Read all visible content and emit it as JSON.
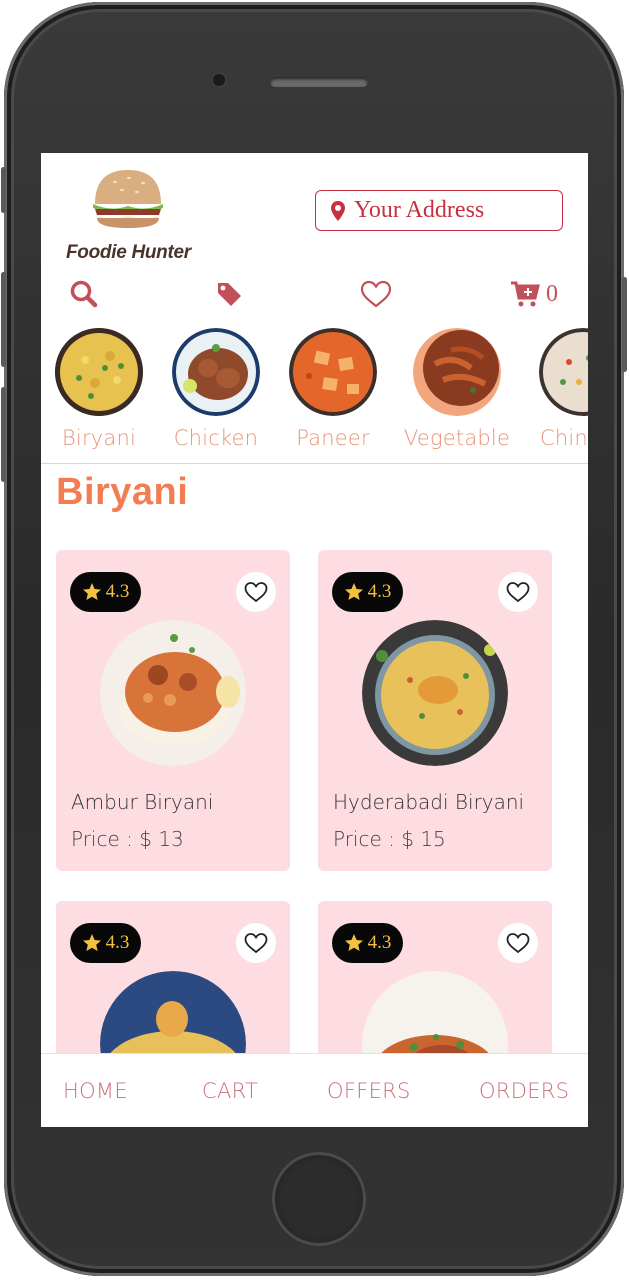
{
  "header": {
    "logo_text": "Foodie Hunter",
    "address_label": "Your Address"
  },
  "iconbar": {
    "icons": [
      "search-icon",
      "tag-icon",
      "heart-icon",
      "cart-plus-icon"
    ],
    "cart_count": "0"
  },
  "categories": [
    {
      "label": "Biryani"
    },
    {
      "label": "Chicken"
    },
    {
      "label": "Paneer"
    },
    {
      "label": "Vegetable"
    },
    {
      "label": "Chin"
    }
  ],
  "section": {
    "title": "Biryani"
  },
  "items": [
    {
      "name": "Ambur Biryani",
      "price": "Price : $ 13",
      "rating": "4.3"
    },
    {
      "name": "Hyderabadi Biryani",
      "price": "Price : $ 15",
      "rating": "4.3"
    },
    {
      "name": "",
      "price": "",
      "rating": "4.3"
    },
    {
      "name": "",
      "price": "",
      "rating": "4.3"
    }
  ],
  "bottom_nav": {
    "home": "HOME",
    "cart": "CART",
    "offers": "OFFERS",
    "orders": "ORDERS"
  },
  "colors": {
    "accent": "#c7313f",
    "title": "#f47c52",
    "card_bg": "#fddde1",
    "category_label": "#e99377"
  }
}
